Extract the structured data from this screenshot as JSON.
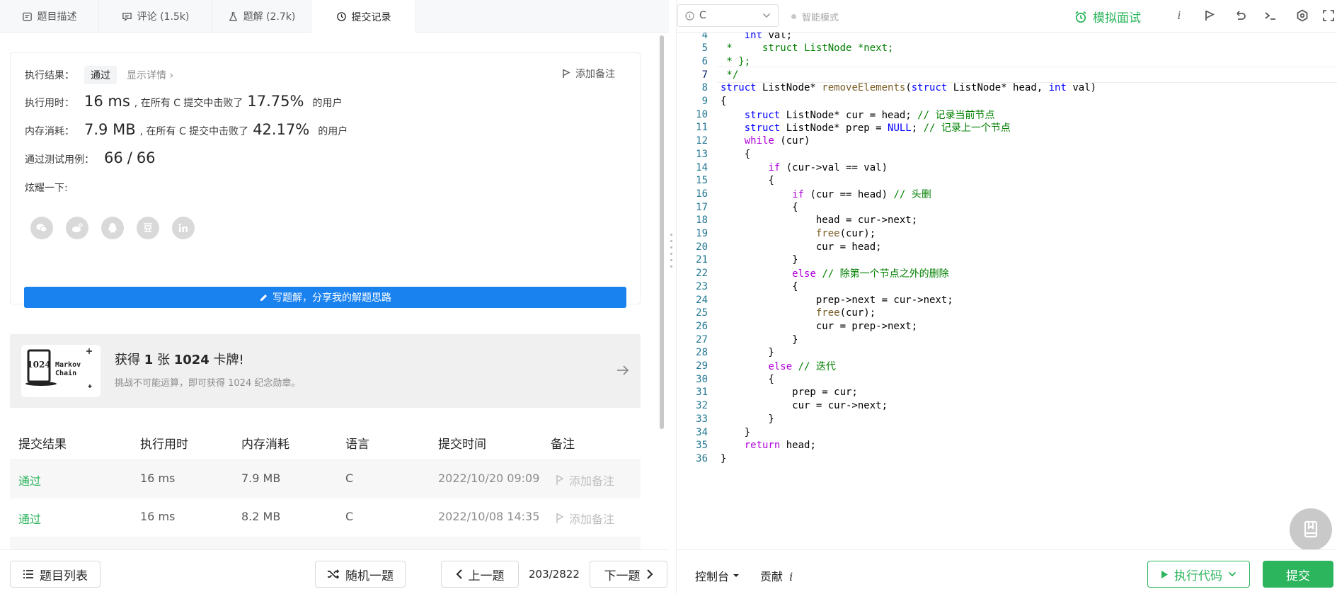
{
  "tabs": [
    {
      "label": "题目描述",
      "icon": "description-icon"
    },
    {
      "label": "评论 (1.5k)",
      "icon": "comment-icon"
    },
    {
      "label": "题解 (2.7k)",
      "icon": "flask-icon"
    },
    {
      "label": "提交记录",
      "icon": "clock-icon"
    }
  ],
  "result": {
    "status_label": "执行结果：",
    "status": "通过",
    "details_link": "显示详情 ›",
    "add_note": "添加备注",
    "runtime_label": "执行用时：",
    "runtime": "16 ms",
    "runtime_text": ", 在所有 C 提交中击败了",
    "runtime_pct": "17.75%",
    "runtime_suffix": "的用户",
    "memory_label": "内存消耗：",
    "memory": "7.9 MB",
    "memory_text": ", 在所有 C 提交中击败了",
    "memory_pct": "42.17%",
    "memory_suffix": "的用户",
    "tests_label": "通过测试用例：",
    "tests_passed": "66",
    "tests_sep": "/",
    "tests_total": "66",
    "share_label": "炫耀一下:",
    "share_icons": [
      "wechat-icon",
      "weibo-icon",
      "qq-icon",
      "douban-icon",
      "linkedin-icon"
    ],
    "write_button": "写题解，分享我的解题思路"
  },
  "badge": {
    "title_pre": "获得 ",
    "title_count": "1",
    "title_mid": " 张 ",
    "title_name": "1024",
    "title_post": " 卡牌!",
    "subtitle": "挑战不可能运算，即可获得 1024 纪念勋章。",
    "card_number": "1024",
    "card_text_1": "Markov",
    "card_text_2": "Chain"
  },
  "table": {
    "headers": [
      "提交结果",
      "执行用时",
      "内存消耗",
      "语言",
      "提交时间",
      "备注"
    ],
    "rows": [
      {
        "result": "通过",
        "runtime": "16 ms",
        "memory": "7.9 MB",
        "lang": "C",
        "time": "2022/10/20 09:09",
        "note": "添加备注"
      },
      {
        "result": "通过",
        "runtime": "16 ms",
        "memory": "8.2 MB",
        "lang": "C",
        "time": "2022/10/08 14:35",
        "note": "添加备注"
      }
    ]
  },
  "bottom_left": {
    "problem_list": "题目列表",
    "random": "随机一题",
    "prev": "上一题",
    "page": "203/2822",
    "next": "下一题"
  },
  "toolbar": {
    "language": "C",
    "smart_mode": "智能模式",
    "mock_interview": "模拟面试",
    "info_icon_label": "i"
  },
  "code": {
    "lines": [
      {
        "n": "4",
        "text": "    int val;"
      },
      {
        "n": "5",
        "text": " *     struct ListNode *next;"
      },
      {
        "n": "6",
        "text": " * };"
      },
      {
        "n": "7",
        "text": " */"
      },
      {
        "n": "8",
        "text": "struct ListNode* removeElements(struct ListNode* head, int val)"
      },
      {
        "n": "9",
        "text": "{"
      },
      {
        "n": "10",
        "text": "    struct ListNode* cur = head; // 记录当前节点"
      },
      {
        "n": "11",
        "text": "    struct ListNode* prep = NULL; // 记录上一个节点"
      },
      {
        "n": "12",
        "text": "    while (cur)"
      },
      {
        "n": "13",
        "text": "    {"
      },
      {
        "n": "14",
        "text": "        if (cur->val == val)"
      },
      {
        "n": "15",
        "text": "        {"
      },
      {
        "n": "16",
        "text": "            if (cur == head) // 头删"
      },
      {
        "n": "17",
        "text": "            {"
      },
      {
        "n": "18",
        "text": "                head = cur->next;"
      },
      {
        "n": "19",
        "text": "                free(cur);"
      },
      {
        "n": "20",
        "text": "                cur = head;"
      },
      {
        "n": "21",
        "text": "            }"
      },
      {
        "n": "22",
        "text": "            else // 除第一个节点之外的删除"
      },
      {
        "n": "23",
        "text": "            {"
      },
      {
        "n": "24",
        "text": "                prep->next = cur->next;"
      },
      {
        "n": "25",
        "text": "                free(cur);"
      },
      {
        "n": "26",
        "text": "                cur = prep->next;"
      },
      {
        "n": "27",
        "text": "            }"
      },
      {
        "n": "28",
        "text": "        }"
      },
      {
        "n": "29",
        "text": "        else // 迭代"
      },
      {
        "n": "30",
        "text": "        {"
      },
      {
        "n": "31",
        "text": "            prep = cur;"
      },
      {
        "n": "32",
        "text": "            cur = cur->next;"
      },
      {
        "n": "33",
        "text": "        }"
      },
      {
        "n": "34",
        "text": "    }"
      },
      {
        "n": "35",
        "text": "    return head;"
      },
      {
        "n": "36",
        "text": "}"
      }
    ]
  },
  "bottom_right": {
    "console": "控制台",
    "contribute": "贡献",
    "contribute_icon": "i",
    "run": "执行代码",
    "submit": "提交"
  },
  "colors": {
    "accent_green": "#2db55d",
    "primary_blue": "#1a82ef",
    "keyword_blue": "#0000ff",
    "control_purple": "#af00db",
    "function_brown": "#795e26",
    "comment_green": "#008000",
    "line_number": "#237893"
  }
}
